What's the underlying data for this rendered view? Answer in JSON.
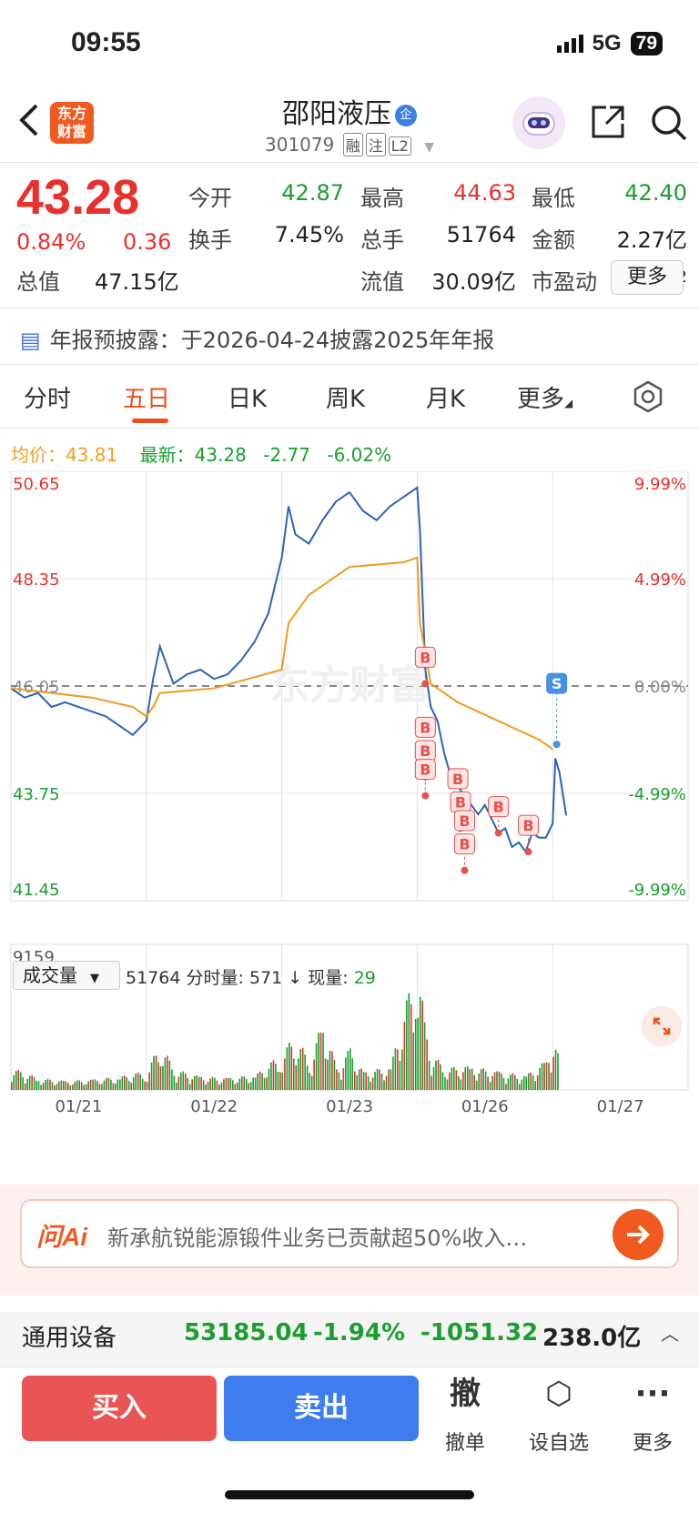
{
  "status_bar": {
    "time": "09:55",
    "network": "5G",
    "battery": "79"
  },
  "header": {
    "stock_name": "邵阳液压",
    "badge": "企",
    "stock_code": "301079",
    "tags": [
      "融",
      "注",
      "L2"
    ]
  },
  "logo": {
    "line1": "东方",
    "line2": "财富"
  },
  "quote": {
    "price": "43.28",
    "change_pct": "0.84%",
    "change_amt": "0.36",
    "fields": [
      {
        "label": "今开",
        "value": "42.87",
        "color": "green"
      },
      {
        "label": "最高",
        "value": "44.63",
        "color": "red"
      },
      {
        "label": "最低",
        "value": "42.40",
        "color": "green"
      },
      {
        "label": "换手",
        "value": "7.45%",
        "color": "black"
      },
      {
        "label": "总手",
        "value": "51764",
        "color": "black"
      },
      {
        "label": "金额",
        "value": "2.27亿",
        "color": "black"
      },
      {
        "label": "总值",
        "value": "47.15亿",
        "color": "black"
      },
      {
        "label": "流值",
        "value": "30.09亿",
        "color": "black"
      },
      {
        "label": "市盈动",
        "value": "1435.72",
        "color": "black"
      }
    ],
    "more_label": "更多"
  },
  "notice": {
    "text": "年报预披露：于2026-04-24披露2025年年报"
  },
  "tabs": [
    "分时",
    "五日",
    "日K",
    "周K",
    "月K",
    "更多"
  ],
  "active_tab": "五日",
  "summary": {
    "avg_label": "均价：",
    "avg_value": "43.81",
    "latest_label": "最新：",
    "latest_value": "43.28",
    "latest_change": "-2.77",
    "latest_pct": "-6.02%"
  },
  "chart_data": {
    "type": "line",
    "title": "",
    "y_ticks_left": [
      "50.65",
      "48.35",
      "46.05",
      "43.75",
      "41.45"
    ],
    "y_ticks_right": [
      "9.99%",
      "4.99%",
      "0.00%",
      "-4.99%",
      "-9.99%"
    ],
    "ylim": [
      41.45,
      50.65
    ],
    "prev_close": 46.05,
    "x_labels": [
      "01/21",
      "01/22",
      "01/23",
      "01/26",
      "01/27"
    ],
    "watermark": "东方财富",
    "series": [
      {
        "x": [
          0,
          0.1,
          0.2,
          0.3,
          0.4,
          0.5,
          0.6,
          0.7,
          0.8,
          0.9,
          1.0,
          1.05,
          1.1,
          1.15,
          1.2,
          1.3,
          1.4,
          1.5,
          1.6,
          1.7,
          1.8,
          1.9,
          2.0,
          2.05,
          2.1,
          2.2,
          2.3,
          2.4,
          2.5,
          2.6,
          2.7,
          2.8,
          2.9,
          3.0,
          3.02,
          3.06,
          3.1,
          3.15,
          3.2,
          3.25,
          3.3,
          3.35,
          3.4,
          3.45,
          3.5,
          3.55,
          3.6,
          3.65,
          3.7,
          3.75,
          3.8,
          3.85,
          3.9,
          3.95,
          4.0,
          4.02,
          4.05,
          4.1
        ],
        "values": [
          46.0,
          45.8,
          45.9,
          45.6,
          45.7,
          45.6,
          45.5,
          45.4,
          45.2,
          45.0,
          45.3,
          46.2,
          46.9,
          46.5,
          46.1,
          46.3,
          46.4,
          46.2,
          46.3,
          46.6,
          47.0,
          47.6,
          48.8,
          49.9,
          49.3,
          49.1,
          49.6,
          50.0,
          50.2,
          49.8,
          49.6,
          49.9,
          50.1,
          50.3,
          49.4,
          46.4,
          45.6,
          45.3,
          44.6,
          44.1,
          43.9,
          43.7,
          43.5,
          43.3,
          43.5,
          43.2,
          42.9,
          43.0,
          42.6,
          42.7,
          42.5,
          42.9,
          42.8,
          42.8,
          43.1,
          44.5,
          44.2,
          43.28
        ]
      },
      {
        "x": [
          0,
          0.3,
          0.6,
          0.9,
          1.0,
          1.05,
          1.1,
          1.5,
          2.0,
          2.05,
          2.2,
          2.5,
          2.9,
          3.0,
          3.02,
          3.1,
          3.3,
          3.6,
          3.9,
          4.0
        ],
        "values": [
          46.0,
          45.9,
          45.8,
          45.6,
          45.4,
          45.6,
          45.9,
          46.0,
          46.4,
          47.4,
          48.0,
          48.6,
          48.7,
          48.8,
          47.4,
          46.1,
          45.7,
          45.3,
          44.9,
          44.7
        ]
      }
    ],
    "markers": [
      {
        "label": "B",
        "x": 3.06,
        "y": 46.1
      },
      {
        "label": "B",
        "x": 3.06,
        "y": 44.6
      },
      {
        "label": "B",
        "x": 3.06,
        "y": 44.1
      },
      {
        "label": "B",
        "x": 3.06,
        "y": 43.7
      },
      {
        "label": "B",
        "x": 3.3,
        "y": 43.5
      },
      {
        "label": "B",
        "x": 3.32,
        "y": 43.0
      },
      {
        "label": "B",
        "x": 3.35,
        "y": 42.6
      },
      {
        "label": "B",
        "x": 3.35,
        "y": 42.1
      },
      {
        "label": "B",
        "x": 3.6,
        "y": 42.9
      },
      {
        "label": "B",
        "x": 3.82,
        "y": 42.5
      },
      {
        "label": "S",
        "x": 4.03,
        "y": 44.8
      }
    ],
    "volume": {
      "max_label": "9159",
      "x": [
        0,
        0.2,
        0.4,
        0.6,
        0.8,
        1.0,
        1.1,
        1.2,
        1.4,
        1.6,
        1.8,
        2.0,
        2.1,
        2.2,
        2.3,
        2.4,
        2.5,
        2.6,
        2.8,
        3.0,
        3.05,
        3.1,
        3.2,
        3.4,
        3.6,
        3.8,
        3.95,
        4.0,
        4.05
      ],
      "values": [
        1500,
        800,
        600,
        700,
        900,
        1300,
        3200,
        1400,
        900,
        800,
        1000,
        2500,
        3800,
        1800,
        4800,
        1500,
        2800,
        1200,
        1600,
        9159,
        4500,
        2500,
        1500,
        1600,
        1200,
        1000,
        2000,
        3800,
        1800
      ]
    }
  },
  "volume_panel": {
    "selector": "成交量",
    "total": "51764",
    "fenshi_label": "分时量:",
    "fenshi_value": "571",
    "arrow": "↓",
    "xian_label": "现量:",
    "xian_value": "29"
  },
  "ai": {
    "logo": "问Ai",
    "text": "新承航锐能源锻件业务已贡献超50%收入…"
  },
  "industry": {
    "name": "通用设备",
    "index": "53185.04",
    "pct": "-1.94%",
    "change": "-1051.32",
    "amount": "238.0亿"
  },
  "actions": {
    "buy": "买入",
    "sell": "卖出",
    "items": [
      {
        "icon": "撤",
        "label": "撤单"
      },
      {
        "icon": "⬡",
        "label": "设自选"
      },
      {
        "icon": "···",
        "label": "更多"
      }
    ]
  }
}
